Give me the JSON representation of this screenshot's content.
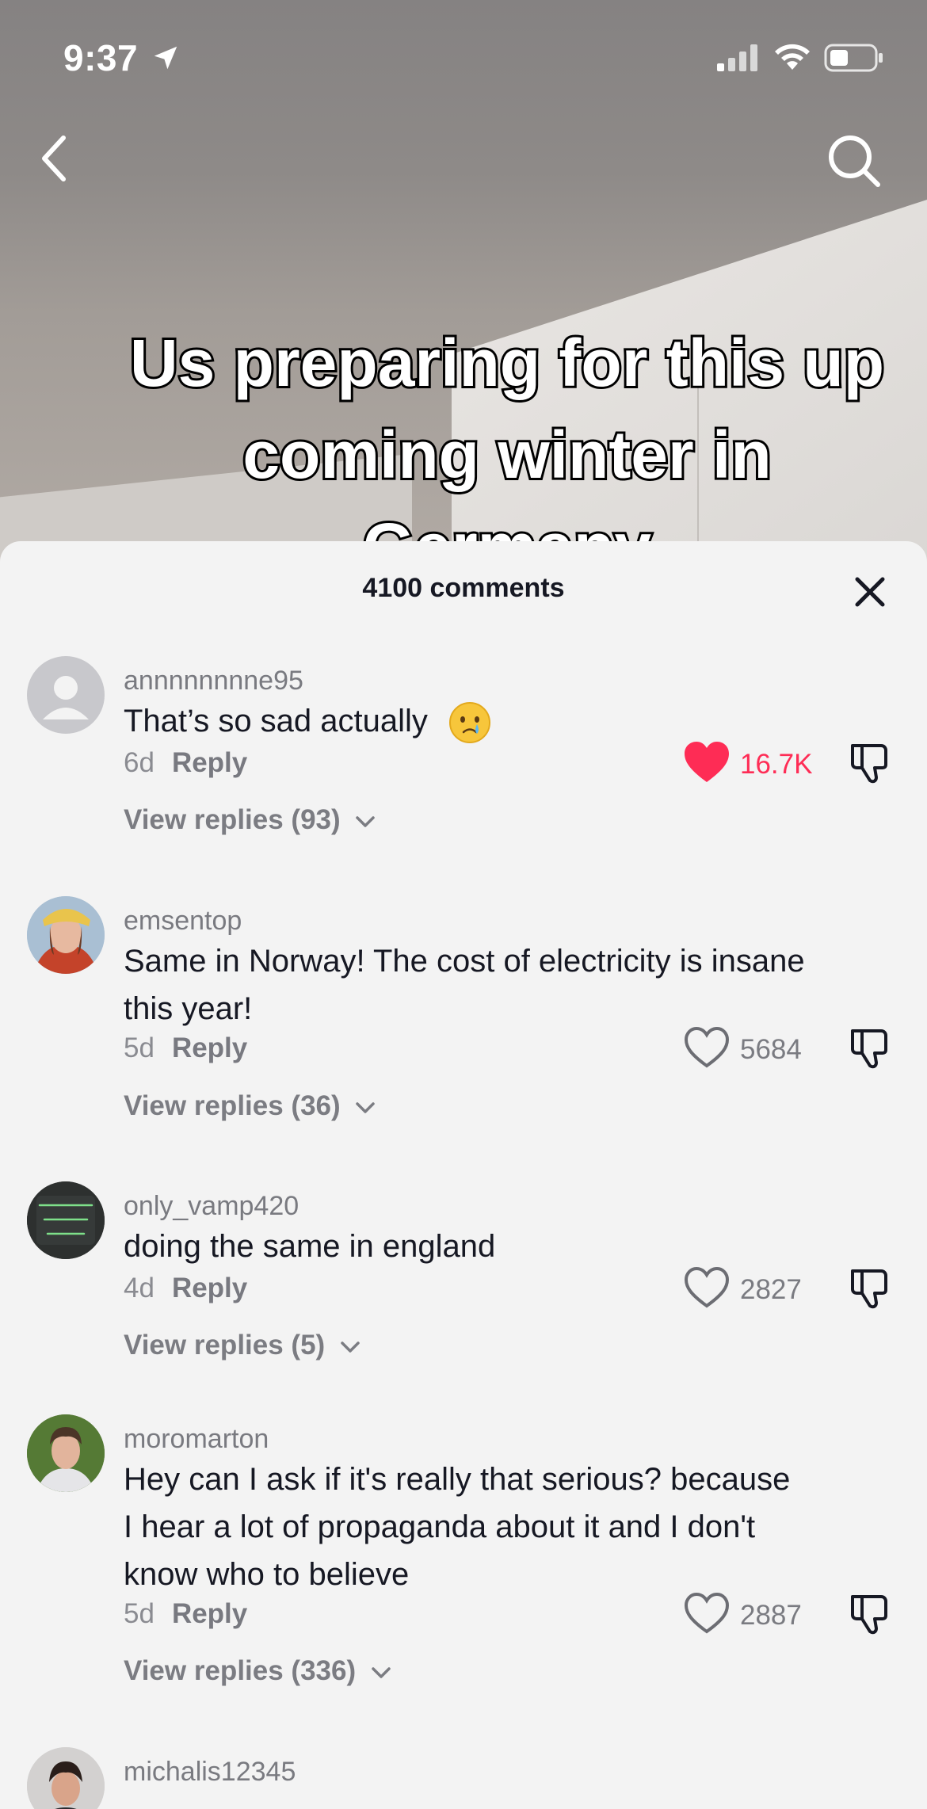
{
  "status": {
    "time": "9:37"
  },
  "video": {
    "caption": "Us preparing for this up coming winter in Germany"
  },
  "comments_panel": {
    "title": "4100 comments",
    "comments": [
      {
        "username": "annnnnnnne95",
        "text": "That’s so sad actually",
        "emoji": "crying-face",
        "age": "6d",
        "reply_label": "Reply",
        "likes": "16.7K",
        "liked": true,
        "view_replies": "View replies (93)"
      },
      {
        "username": "emsentop",
        "text": "Same in Norway! The cost of electricity is insane this year!",
        "age": "5d",
        "reply_label": "Reply",
        "likes": "5684",
        "liked": false,
        "view_replies": "View replies (36)"
      },
      {
        "username": "only_vamp420",
        "text": "doing the same in england",
        "avatar_text": "-ONLY VAMP 420-",
        "age": "4d",
        "reply_label": "Reply",
        "likes": "2827",
        "liked": false,
        "view_replies": "View replies (5)"
      },
      {
        "username": "moromarton",
        "text": "Hey can I ask if it's really that serious? because I hear a lot of propaganda about it and I don't know who to believe",
        "age": "5d",
        "reply_label": "Reply",
        "likes": "2887",
        "liked": false,
        "view_replies": "View replies (336)"
      },
      {
        "username": "michalis12345"
      }
    ]
  },
  "colors": {
    "accent_like": "#fe2c55",
    "text_primary": "#161823",
    "text_secondary": "#8a8b91"
  }
}
